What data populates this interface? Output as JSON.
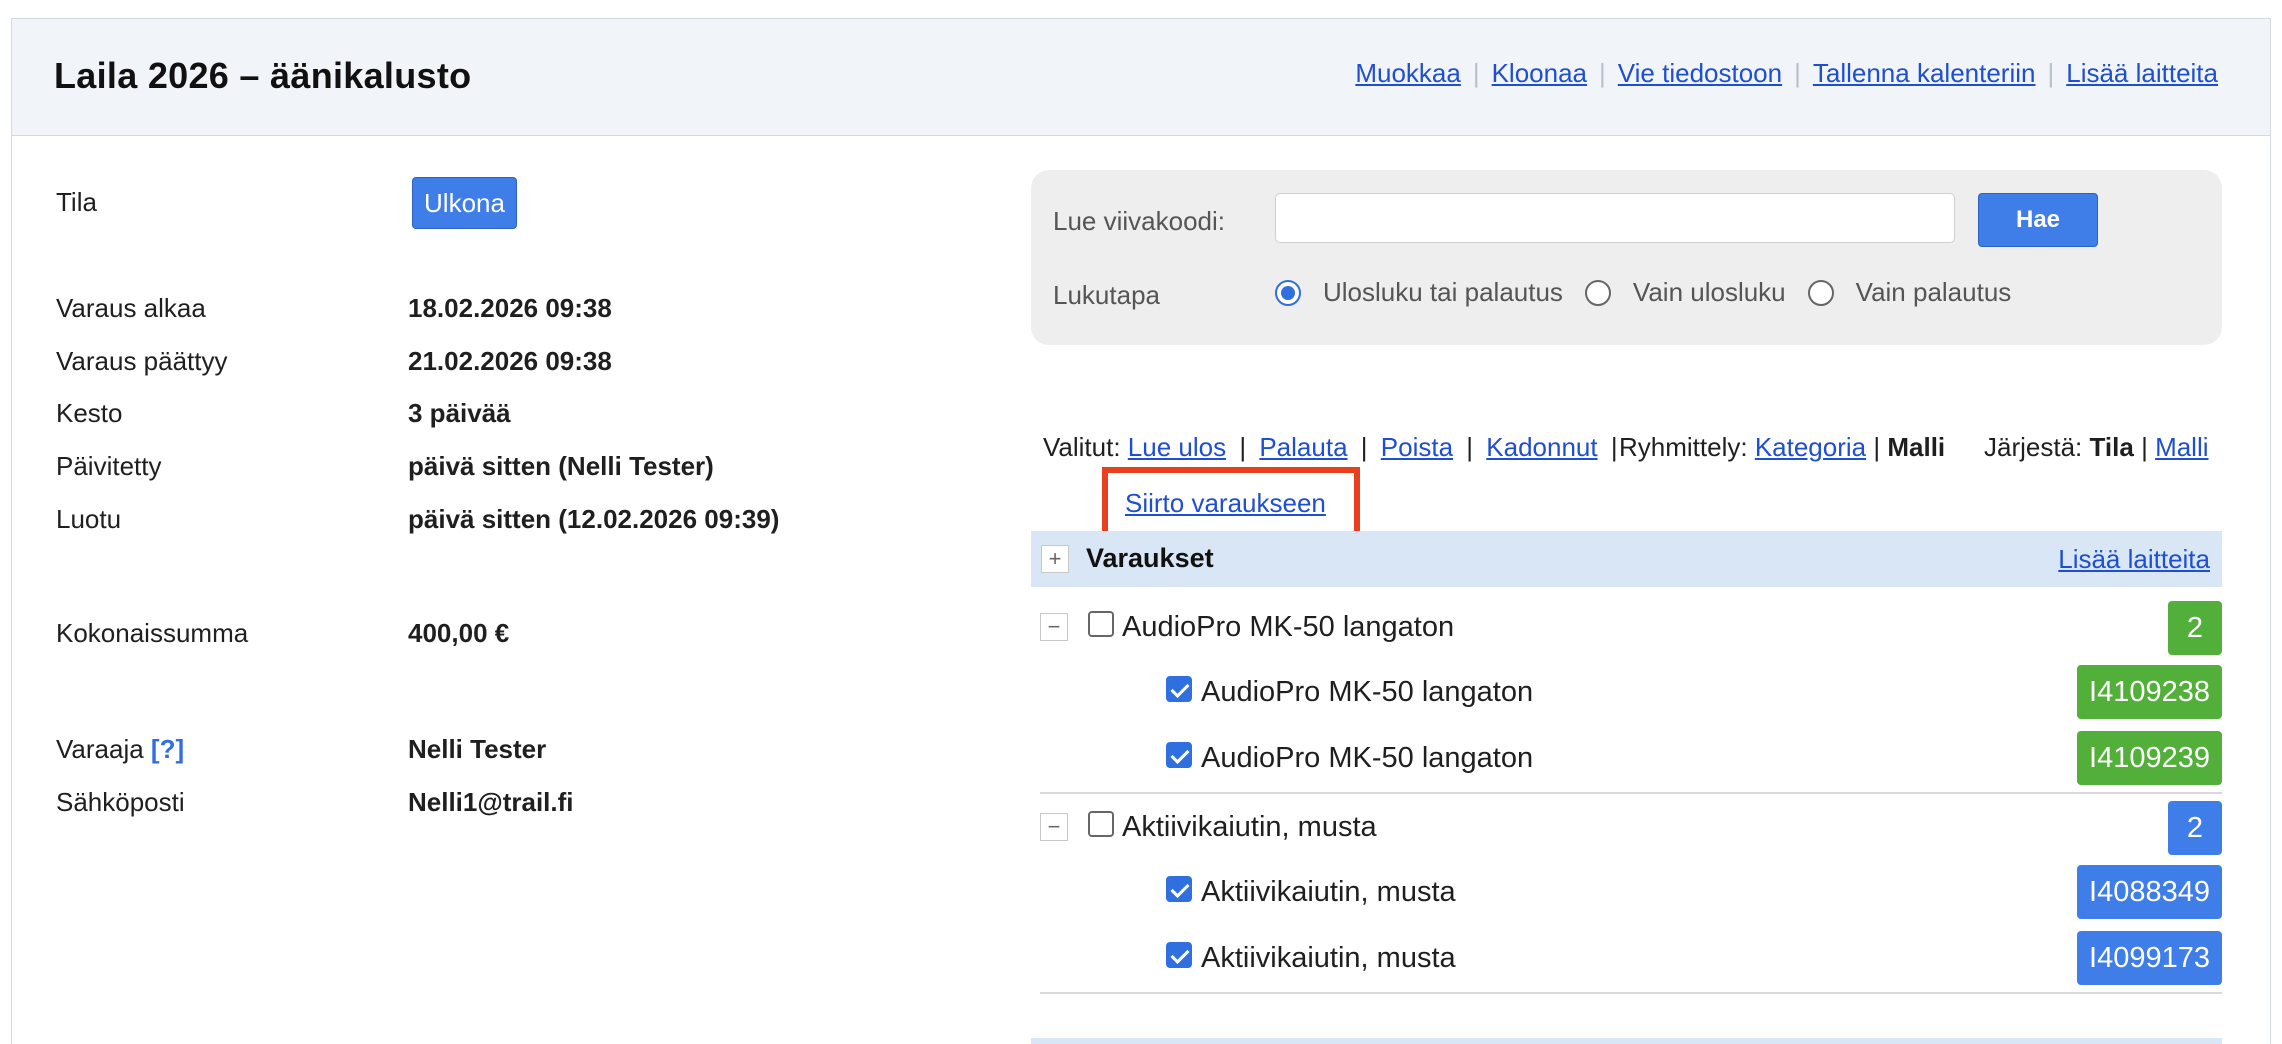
{
  "header": {
    "title": "Laila 2026 – äänikalusto",
    "actions": [
      "Muokkaa",
      "Kloonaa",
      "Vie tiedostoon",
      "Tallenna kalenteriin",
      "Lisää laitteita"
    ]
  },
  "details": {
    "status_label": "Tila",
    "status_value": "Ulkona",
    "start_label": "Varaus alkaa",
    "start_value": "18.02.2026 09:38",
    "end_label": "Varaus päättyy",
    "end_value": "21.02.2026 09:38",
    "duration_label": "Kesto",
    "duration_value": "3 päivää",
    "updated_label": "Päivitetty",
    "updated_value": "päivä sitten (Nelli Tester)",
    "created_label": "Luotu",
    "created_value": "päivä sitten (12.02.2026 09:39)",
    "total_label": "Kokonaissumma",
    "total_value": "400,00 €",
    "booker_label": "Varaaja",
    "booker_help": "[?]",
    "booker_value": "Nelli Tester",
    "email_label": "Sähköposti",
    "email_value": "Nelli1@trail.fi"
  },
  "scan": {
    "barcode_label": "Lue viivakoodi:",
    "barcode_value": "",
    "search_button": "Hae",
    "mode_label": "Lukutapa",
    "modes": [
      {
        "label": "Ulosluku tai palautus",
        "selected": true
      },
      {
        "label": "Vain ulosluku",
        "selected": false
      },
      {
        "label": "Vain palautus",
        "selected": false
      }
    ]
  },
  "actions": {
    "selected_label": "Valitut:",
    "links": [
      "Lue ulos",
      "Palauta",
      "Poista",
      "Kadonnut"
    ],
    "pipe": "|",
    "transfer_link": "Siirto varaukseen",
    "grouping_label": "Ryhmittely:",
    "grouping_link": "Kategoria",
    "grouping_active": "Malli",
    "sort_label": "Järjestä:",
    "sort_active": "Tila",
    "sort_link": "Malli"
  },
  "list": {
    "expand_symbol": "+",
    "collapse_symbol": "−",
    "title": "Varaukset",
    "add_link": "Lisää laitteita",
    "groups": [
      {
        "name": "AudioPro MK-50 langaton",
        "count": "2",
        "badge_color": "#52b03a",
        "items": [
          {
            "name": "AudioPro MK-50 langaton",
            "code": "I4109238",
            "checked": true
          },
          {
            "name": "AudioPro MK-50 langaton",
            "code": "I4109239",
            "checked": true
          }
        ]
      },
      {
        "name": "Aktiivikaiutin, musta",
        "count": "2",
        "badge_color": "#3f7de8",
        "items": [
          {
            "name": "Aktiivikaiutin, musta",
            "code": "I4088349",
            "checked": true
          },
          {
            "name": "Aktiivikaiutin, musta",
            "code": "I4099173",
            "checked": true
          }
        ]
      }
    ]
  }
}
